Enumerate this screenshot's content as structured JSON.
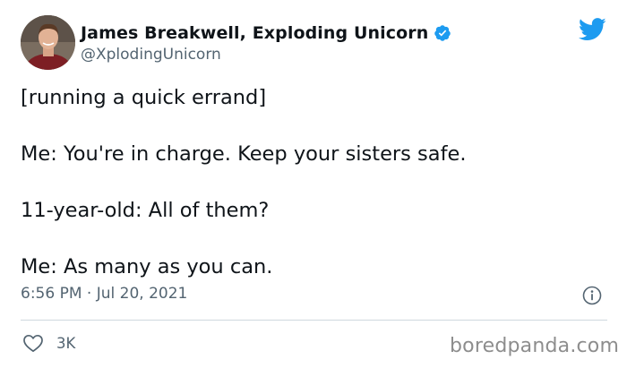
{
  "author": {
    "name": "James Breakwell, Exploding Unicorn",
    "handle": "@XplodingUnicorn",
    "avatar_icon": "avatar-photo",
    "verified_icon": "verified-badge-icon"
  },
  "brand": {
    "icon": "twitter-bird-icon",
    "color": "#1d9bf0"
  },
  "tweet": {
    "lines": [
      "[running a quick errand]",
      "Me: You're in charge. Keep your sisters safe.",
      "11-year-old: All of them?",
      "Me: As many as you can."
    ],
    "timestamp": "6:56 PM · Jul 20, 2021"
  },
  "actions": {
    "like_icon": "heart-icon",
    "like_count": "3K",
    "info_icon": "info-icon"
  },
  "watermark": "boredpanda.com",
  "colors": {
    "text": "#0f1419",
    "secondary": "#536471",
    "divider": "#cfd9de",
    "watermark": "#8d8d8d"
  }
}
